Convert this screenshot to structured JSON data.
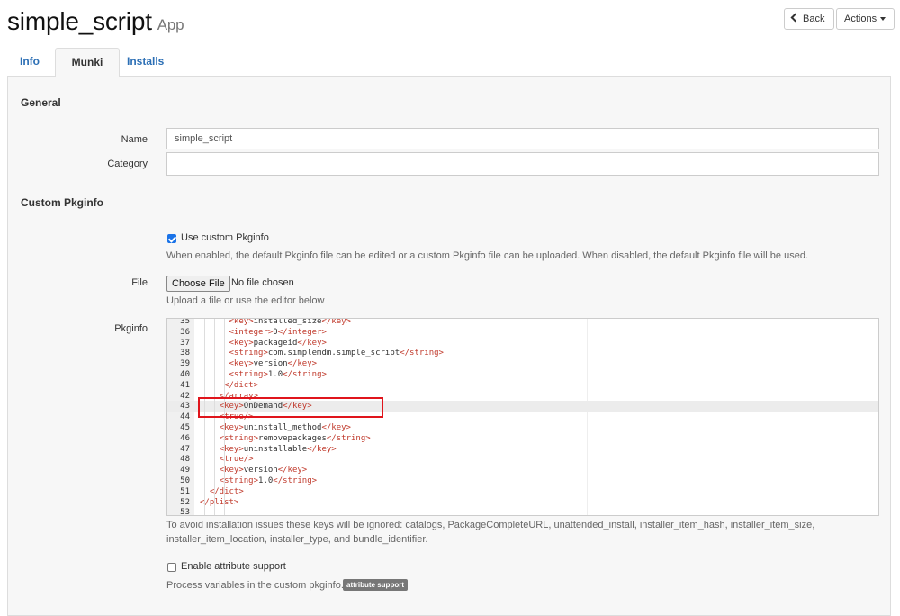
{
  "header": {
    "title": "simple_script",
    "subtitle": "App",
    "back_label": "Back",
    "actions_label": "Actions"
  },
  "tabs": [
    {
      "label": "Info",
      "active": false
    },
    {
      "label": "Munki",
      "active": true
    },
    {
      "label": "Installs",
      "active": false
    }
  ],
  "general": {
    "section_title": "General",
    "name_label": "Name",
    "name_value": "simple_script",
    "category_label": "Category",
    "category_value": ""
  },
  "custom_pkginfo": {
    "section_title": "Custom Pkginfo",
    "use_custom_label": "Use custom Pkginfo",
    "use_custom_checked": true,
    "use_custom_help": "When enabled, the default Pkginfo file can be edited or a custom Pkginfo file can be uploaded. When disabled, the default Pkginfo file will be used.",
    "file_label": "File",
    "choose_file_label": "Choose File",
    "no_file_text": "No file chosen",
    "file_help": "Upload a file or use the editor below",
    "pkginfo_label": "Pkginfo",
    "ignored_help_line1": "To avoid installation issues these keys will be ignored: catalogs, PackageCompleteURL, unattended_install, installer_item_hash, installer_item_size,",
    "ignored_help_line2": "installer_item_location, installer_type, and bundle_identifier.",
    "attr_support_label": "Enable attribute support",
    "attr_support_checked": false,
    "attr_help": "Process variables in the custom pkginfo.",
    "attr_badge": "attribute support"
  },
  "editor": {
    "active_line": 43,
    "lines": [
      {
        "n": "35",
        "indent": 6,
        "tag": "key",
        "text": "installed_size",
        "selfclose": false
      },
      {
        "n": "36",
        "indent": 6,
        "tag": "integer",
        "text": "0",
        "selfclose": false
      },
      {
        "n": "37",
        "indent": 6,
        "tag": "key",
        "text": "packageid",
        "selfclose": false
      },
      {
        "n": "38",
        "indent": 6,
        "tag": "string",
        "text": "com.simplemdm.simple_script",
        "selfclose": false
      },
      {
        "n": "39",
        "indent": 6,
        "tag": "key",
        "text": "version",
        "selfclose": false
      },
      {
        "n": "40",
        "indent": 6,
        "tag": "string",
        "text": "1.0",
        "selfclose": false
      },
      {
        "n": "41",
        "indent": 5,
        "close": "dict"
      },
      {
        "n": "42",
        "indent": 4,
        "close": "array"
      },
      {
        "n": "43",
        "indent": 4,
        "tag": "key",
        "text": "OnDemand",
        "selfclose": false
      },
      {
        "n": "44",
        "indent": 4,
        "tag": "true",
        "selfclose": true
      },
      {
        "n": "45",
        "indent": 4,
        "tag": "key",
        "text": "uninstall_method",
        "selfclose": false
      },
      {
        "n": "46",
        "indent": 4,
        "tag": "string",
        "text": "removepackages",
        "selfclose": false
      },
      {
        "n": "47",
        "indent": 4,
        "tag": "key",
        "text": "uninstallable",
        "selfclose": false
      },
      {
        "n": "48",
        "indent": 4,
        "tag": "true",
        "selfclose": true
      },
      {
        "n": "49",
        "indent": 4,
        "tag": "key",
        "text": "version",
        "selfclose": false
      },
      {
        "n": "50",
        "indent": 4,
        "tag": "string",
        "text": "1.0",
        "selfclose": false
      },
      {
        "n": "51",
        "indent": 2,
        "close": "dict"
      },
      {
        "n": "52",
        "indent": 0,
        "close": "plist"
      },
      {
        "n": "53",
        "indent": 0,
        "empty": true
      }
    ]
  },
  "colors": {
    "link": "#2c6fb5",
    "xml_tag": "#c0392b",
    "checkbox": "#1a73e8",
    "highlight_box": "#e0151c"
  }
}
